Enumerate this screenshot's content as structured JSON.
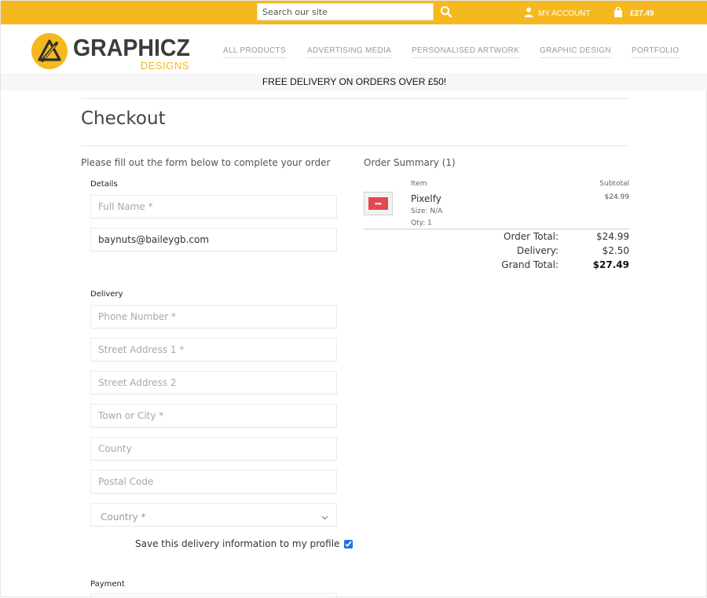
{
  "topbar": {
    "search_placeholder": "Search our site",
    "account_label": "MY ACCOUNT",
    "basket_total": "£27.49",
    "brand_color": "#f5b81f"
  },
  "header": {
    "logo_main": "GRAPHICZ",
    "logo_sub": "DESIGNS",
    "nav": [
      "ALL PRODUCTS",
      "ADVERTISING MEDIA",
      "PERSONALISED ARTWORK",
      "GRAPHIC DESIGN",
      "PORTFOLIO"
    ]
  },
  "promo": "FREE DELIVERY ON ORDERS OVER £50!",
  "checkout": {
    "title": "Checkout",
    "intro": "Please fill out the form below to complete your order",
    "details_label": "Details",
    "full_name_placeholder": "Full Name *",
    "email_value": "baynuts@baileygb.com",
    "delivery_label": "Delivery",
    "phone_placeholder": "Phone Number *",
    "street1_placeholder": "Street Address 1 *",
    "street2_placeholder": "Street Address 2",
    "town_placeholder": "Town or City *",
    "county_placeholder": "County",
    "postcode_placeholder": "Postal Code",
    "country_value": "Country *",
    "save_label": "Save this delivery information to my profile",
    "save_checked": true,
    "payment_label": "Payment"
  },
  "summary": {
    "title": "Order Summary (1)",
    "col_item": "Item",
    "col_subtotal": "Subtotal",
    "item": {
      "name": "Pixelfy",
      "size": "Size: N/A",
      "qty": "Qty: 1",
      "subtotal": "$24.99"
    },
    "order_total_label": "Order Total:",
    "order_total": "$24.99",
    "delivery_label": "Delivery:",
    "delivery": "$2.50",
    "grand_total_label": "Grand Total:",
    "grand_total": "$27.49"
  }
}
